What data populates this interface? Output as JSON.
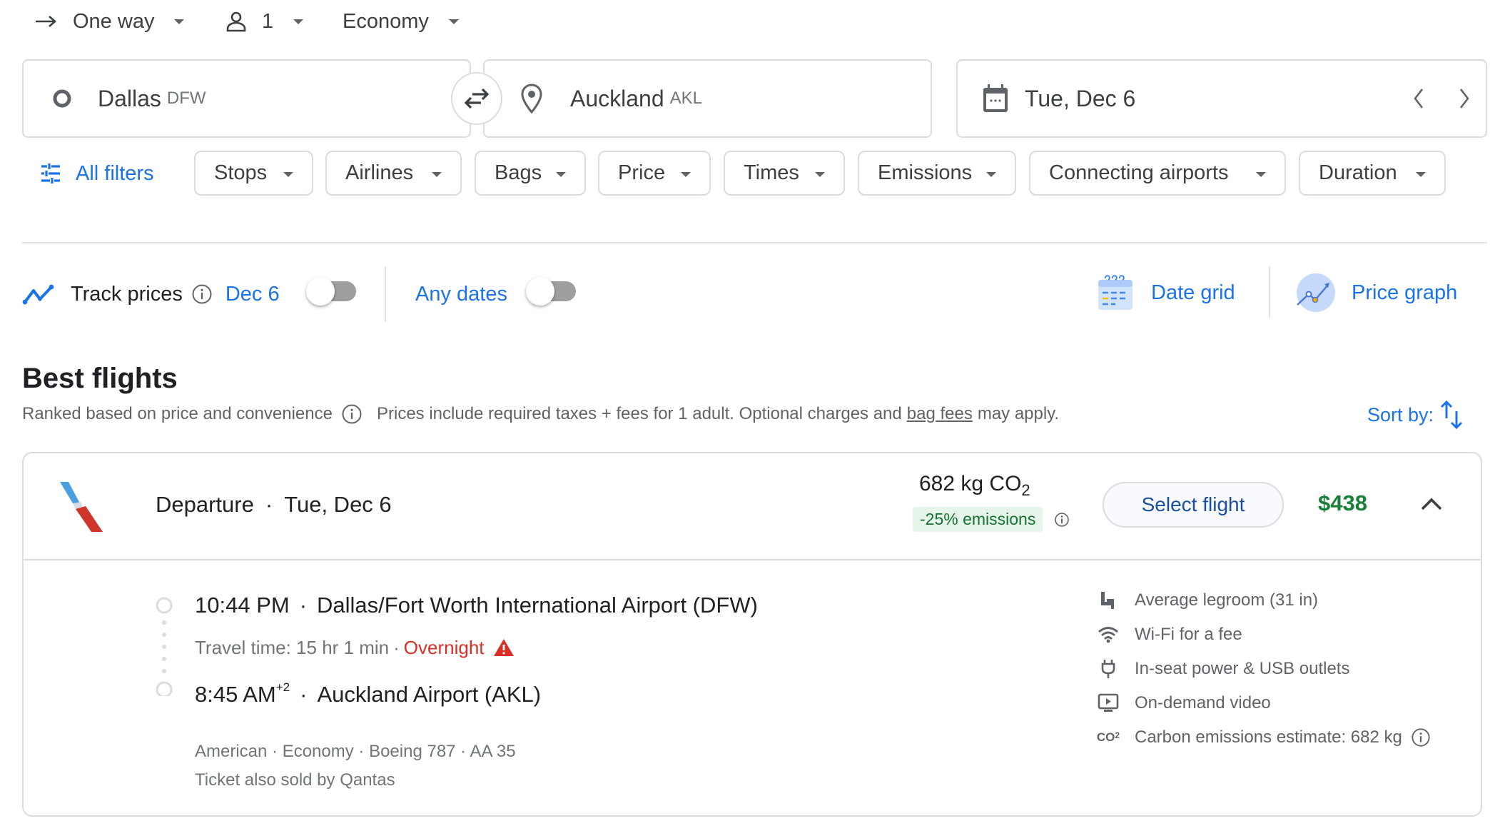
{
  "trip_options": {
    "trip_type": "One way",
    "passengers": "1",
    "cabin_class": "Economy"
  },
  "search": {
    "origin": {
      "city": "Dallas",
      "code": "DFW"
    },
    "destination": {
      "city": "Auckland",
      "code": "AKL"
    },
    "date": "Tue, Dec 6"
  },
  "filters": {
    "all_filters_label": "All filters",
    "chips": [
      "Stops",
      "Airlines",
      "Bags",
      "Price",
      "Times",
      "Emissions",
      "Connecting airports",
      "Duration"
    ]
  },
  "tracking": {
    "track_prices_label": "Track prices",
    "date_label": "Dec 6",
    "date_toggle_on": false,
    "any_dates_label": "Any dates",
    "any_dates_toggle_on": false,
    "date_grid_label": "Date grid",
    "price_graph_label": "Price graph"
  },
  "results": {
    "heading": "Best flights",
    "ranked_note": "Ranked based on price and convenience",
    "price_note_prefix": "Prices include required taxes + fees for 1 adult. Optional charges and",
    "bag_fees_link": "bag fees",
    "price_note_suffix": "may apply.",
    "sort_label": "Sort by:"
  },
  "flight": {
    "header_label": "Departure",
    "header_date": "Tue, Dec 6",
    "emissions_value": "682 kg CO",
    "emissions_sub": "2",
    "emissions_badge": "-25% emissions",
    "select_button": "Select flight",
    "price": "$438",
    "departure_time": "10:44 PM",
    "departure_airport": "Dallas/Fort Worth International Airport (DFW)",
    "travel_time": "Travel time: 15 hr 1 min",
    "overnight_label": "Overnight",
    "arrival_time": "8:45 AM",
    "arrival_day_offset": "+2",
    "arrival_airport": "Auckland Airport (AKL)",
    "details_line": "American · Economy · Boeing 787 · AA 35",
    "also_sold_by": "Ticket also sold by Qantas",
    "amenities": [
      {
        "icon": "legroom-icon",
        "label": "Average legroom (31 in)"
      },
      {
        "icon": "wifi-icon",
        "label": "Wi-Fi for a fee"
      },
      {
        "icon": "power-plug-icon",
        "label": "In-seat power & USB outlets"
      },
      {
        "icon": "video-icon",
        "label": "On-demand video"
      },
      {
        "icon": "co2-icon",
        "label": "Carbon emissions estimate: 682 kg"
      }
    ]
  },
  "colors": {
    "accent_blue": "#1a73e8",
    "price_green": "#188038",
    "overnight_red": "#d93025",
    "emissions_badge_bg": "#e6f4ea"
  }
}
